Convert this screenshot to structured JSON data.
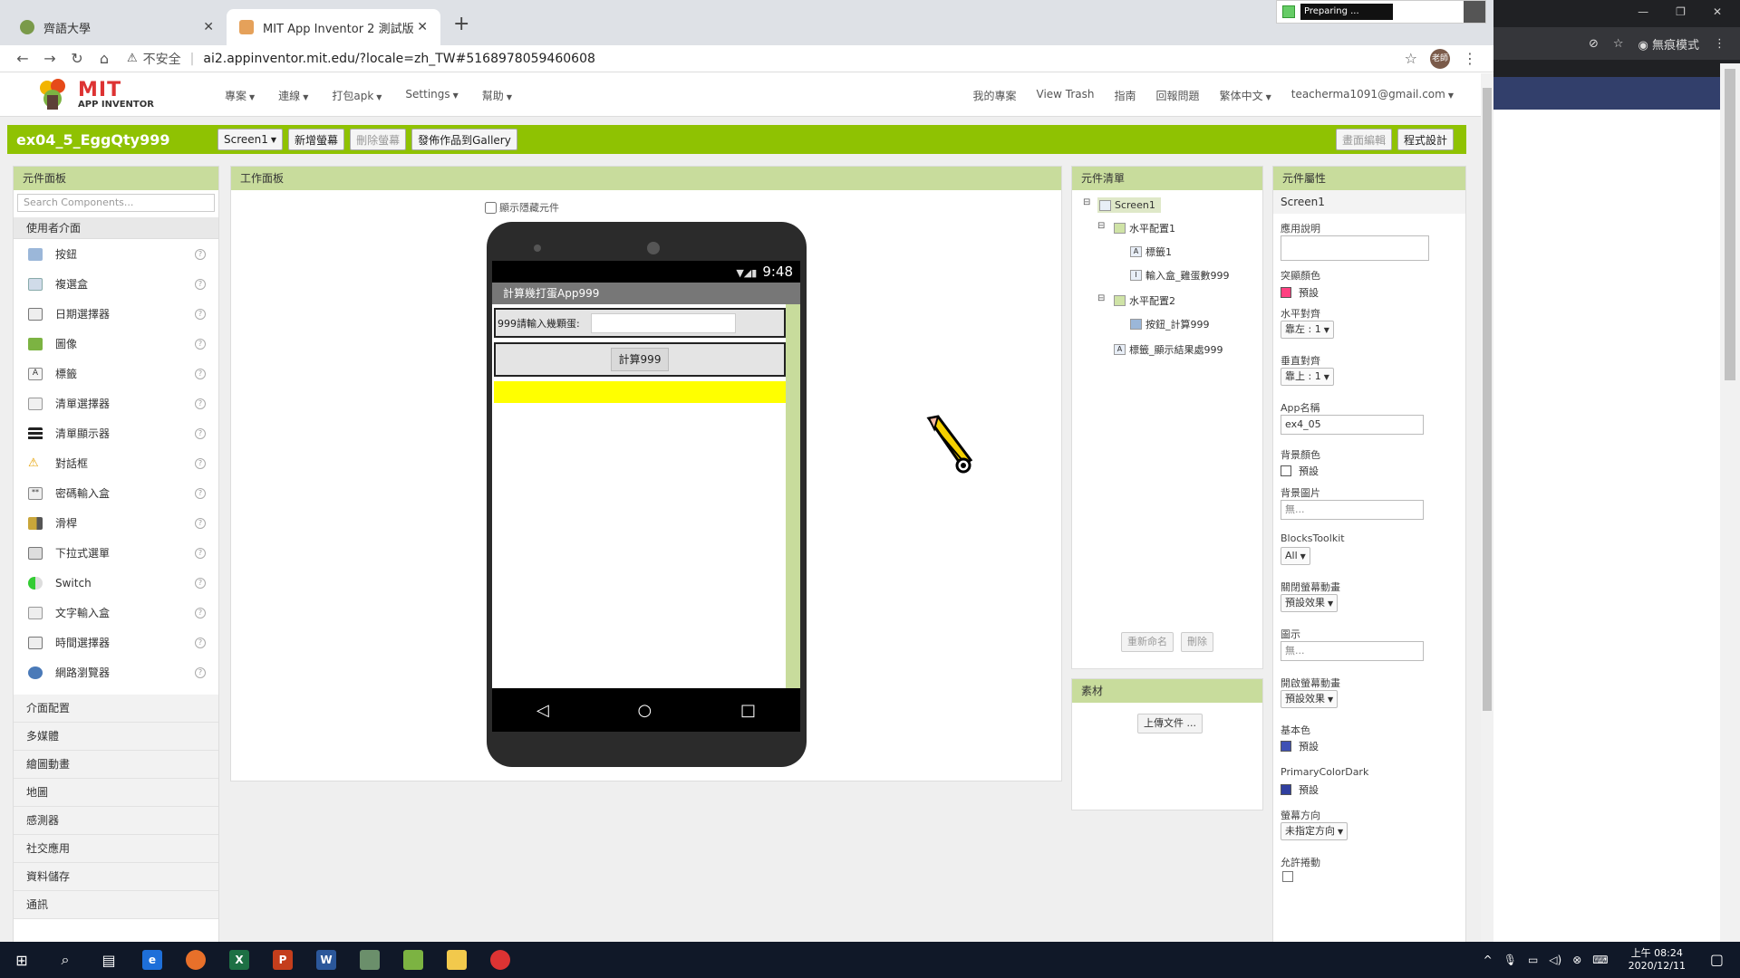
{
  "browser": {
    "tabs": [
      {
        "title": "齊語大學"
      },
      {
        "title": "MIT App Inventor 2 測試版"
      }
    ],
    "preparing": "Preparing ...",
    "insecure": "不安全",
    "url": "ai2.appinventor.mit.edu/?locale=zh_TW#5168978059460608",
    "avatar": "老師"
  },
  "logo": {
    "top": "MIT",
    "bottom": "APP INVENTOR"
  },
  "topnav": {
    "left": [
      "專案",
      "連線",
      "打包apk",
      "Settings",
      "幫助"
    ],
    "right": [
      "我的專案",
      "View Trash",
      "指南",
      "回報問題",
      "繁体中文",
      "teacherma1091@gmail.com"
    ]
  },
  "projectbar": {
    "title": "ex04_5_EggQty999",
    "screen": "Screen1",
    "add_screen": "新增螢幕",
    "remove_screen": "刪除螢幕",
    "publish": "發佈作品到Gallery",
    "designer": "畫面編輯",
    "blocks": "程式設計"
  },
  "palette": {
    "title": "元件面板",
    "search_placeholder": "Search Components...",
    "category": "使用者介面",
    "items": [
      "按鈕",
      "複選盒",
      "日期選擇器",
      "圖像",
      "標籤",
      "清單選擇器",
      "清單顯示器",
      "對話框",
      "密碼輸入盒",
      "滑桿",
      "下拉式選單",
      "Switch",
      "文字輸入盒",
      "時間選擇器",
      "網路瀏覽器"
    ],
    "categories": [
      "介面配置",
      "多媒體",
      "繪圖動畫",
      "地圖",
      "感測器",
      "社交應用",
      "資料儲存",
      "通訊"
    ]
  },
  "viewer": {
    "title": "工作面板",
    "show_hidden": "顯示隱藏元件",
    "time": "9:48",
    "app_title": "計算幾打蛋App999",
    "input_label": "999請輸入幾顆蛋:",
    "button_label": "計算999"
  },
  "components": {
    "title": "元件清單",
    "tree": [
      "Screen1",
      "水平配置1",
      "標籤1",
      "輸入盒_雞蛋數999",
      "水平配置2",
      "按鈕_計算999",
      "標籤_顯示結果處999"
    ],
    "rename": "重新命名",
    "delete": "刪除"
  },
  "media": {
    "title": "素材",
    "upload": "上傳文件 ..."
  },
  "properties": {
    "title": "元件屬性",
    "selected": "Screen1",
    "items": {
      "about": "應用說明",
      "accent": "突顯顏色",
      "accent_val": "預設",
      "halign": "水平對齊",
      "halign_val": "靠左 : 1",
      "valign": "垂直對齊",
      "valign_val": "靠上 : 1",
      "appname": "App名稱",
      "appname_val": "ex4_05",
      "bgcolor": "背景顏色",
      "bgcolor_val": "預設",
      "bgimage": "背景圖片",
      "bgimage_val": "無...",
      "blocks_toolkit": "BlocksToolkit",
      "blocks_toolkit_val": "All",
      "close_anim": "關閉螢幕動畫",
      "close_anim_val": "預設效果",
      "icon": "圖示",
      "icon_val": "無...",
      "open_anim": "開啟螢幕動畫",
      "open_anim_val": "預設效果",
      "primary": "基本色",
      "primary_val": "預設",
      "primary_dark": "PrimaryColorDark",
      "primary_dark_val": "預設",
      "orientation": "螢幕方向",
      "orientation_val": "未指定方向",
      "scrollable": "允許捲動"
    }
  },
  "incognito": {
    "label": "無痕模式"
  },
  "taskbar": {
    "time": "上午 08:24",
    "date": "2020/12/11"
  },
  "colors": {
    "green": "#8fc202",
    "accent": "#ff4081",
    "primary": "#3f51b5",
    "primary_dark": "#303f9f"
  }
}
